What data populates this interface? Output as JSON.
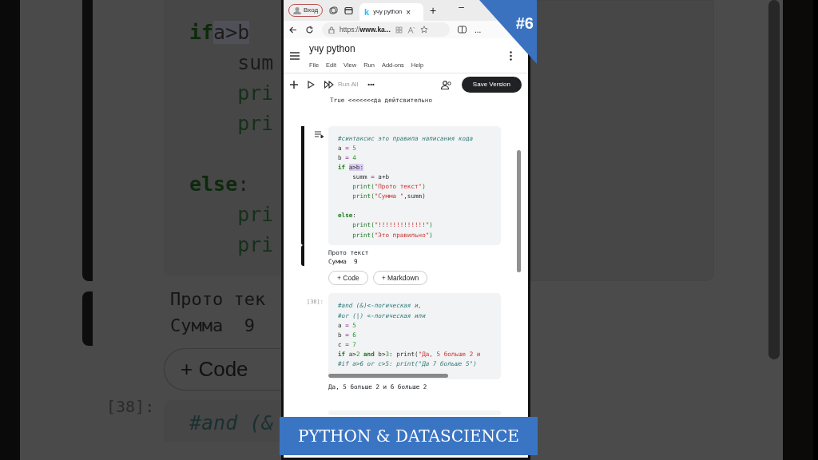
{
  "backdrop": {
    "code_lines": [
      {
        "kind": "code",
        "tokens": [
          {
            "text": "if",
            "kind": "keyword"
          },
          {
            "text": "a>b",
            "kind": "selection"
          }
        ]
      },
      {
        "kind": "code",
        "tokens": [
          {
            "text": "    sum",
            "kind": "plain"
          }
        ]
      },
      {
        "kind": "code",
        "tokens": [
          {
            "text": "    pri",
            "kind": "func"
          }
        ]
      },
      {
        "kind": "code",
        "tokens": [
          {
            "text": "    pri",
            "kind": "func"
          }
        ]
      },
      {
        "kind": "blank"
      },
      {
        "kind": "code",
        "tokens": [
          {
            "text": "else",
            "kind": "keyword"
          },
          {
            "text": ":",
            "kind": "plain"
          }
        ]
      },
      {
        "kind": "code",
        "tokens": [
          {
            "text": "    pri",
            "kind": "func"
          }
        ]
      },
      {
        "kind": "code",
        "tokens": [
          {
            "text": "    pri",
            "kind": "func"
          }
        ]
      }
    ],
    "output": [
      "Прото тек",
      "Сумма  9"
    ],
    "add_button": "+ Code",
    "prompt": "[38]:",
    "next_line": {
      "kind": "code",
      "tokens": [
        {
          "text": "#and (&",
          "kind": "comment"
        }
      ]
    }
  },
  "browser": {
    "profile": "Вход",
    "tab": {
      "icon_letter": "k",
      "title": "учу python",
      "close": "×"
    },
    "new_tab": "+",
    "minimize": "–",
    "url": {
      "scheme": "https://",
      "host": "www.ka..."
    },
    "more": "..."
  },
  "notebook": {
    "title": "учу python",
    "menu": [
      "File",
      "Edit",
      "View",
      "Run",
      "Add-ons",
      "Help"
    ],
    "toolbar": {
      "run_all": "Run All",
      "more": "•••",
      "save": "Save Version"
    },
    "prev_output": "True <<<<<<<да дейтсвительно",
    "cells": [
      {
        "selected": true,
        "hscroll": false,
        "lines": [
          {
            "kind": "code",
            "tokens": [
              {
                "text": "#синтаксис это правила написания кода",
                "kind": "comment"
              }
            ]
          },
          {
            "kind": "code",
            "tokens": [
              {
                "text": "a ",
                "kind": "plain"
              },
              {
                "text": "=",
                "kind": "op"
              },
              {
                "text": " 5",
                "kind": "number"
              }
            ]
          },
          {
            "kind": "code",
            "tokens": [
              {
                "text": "b ",
                "kind": "plain"
              },
              {
                "text": "=",
                "kind": "op"
              },
              {
                "text": " 4",
                "kind": "number"
              }
            ]
          },
          {
            "kind": "code",
            "tokens": [
              {
                "text": "if ",
                "kind": "keyword"
              },
              {
                "text": "a>b:",
                "kind": "selection"
              }
            ]
          },
          {
            "kind": "code",
            "tokens": [
              {
                "text": "    summ ",
                "kind": "plain"
              },
              {
                "text": "=",
                "kind": "op"
              },
              {
                "text": " a+b",
                "kind": "plain"
              }
            ]
          },
          {
            "kind": "code",
            "tokens": [
              {
                "text": "    print(",
                "kind": "func"
              },
              {
                "text": "\"Прото текст\"",
                "kind": "string"
              },
              {
                "text": ")",
                "kind": "func"
              }
            ]
          },
          {
            "kind": "code",
            "tokens": [
              {
                "text": "    print(",
                "kind": "func"
              },
              {
                "text": "\"Сумма \"",
                "kind": "string"
              },
              {
                "text": ",summ)",
                "kind": "plain"
              }
            ]
          },
          {
            "kind": "blank"
          },
          {
            "kind": "code",
            "tokens": [
              {
                "text": "else",
                "kind": "keyword"
              },
              {
                "text": ":",
                "kind": "plain"
              }
            ]
          },
          {
            "kind": "code",
            "tokens": [
              {
                "text": "    print(",
                "kind": "func"
              },
              {
                "text": "\"!!!!!!!!!!!!!\"",
                "kind": "string"
              },
              {
                "text": ")",
                "kind": "func"
              }
            ]
          },
          {
            "kind": "code",
            "tokens": [
              {
                "text": "    print(",
                "kind": "func"
              },
              {
                "text": "\"Это правильно\"",
                "kind": "string"
              },
              {
                "text": ")",
                "kind": "func"
              }
            ]
          }
        ],
        "output": [
          "Прото текст",
          "Сумма  9"
        ],
        "add_buttons": [
          "+ Code",
          "+ Markdown"
        ]
      },
      {
        "selected": false,
        "prompt": "[38]:",
        "hscroll": true,
        "lines": [
          {
            "kind": "code",
            "tokens": [
              {
                "text": "#and (&)<-логическая и,",
                "kind": "comment"
              }
            ]
          },
          {
            "kind": "code",
            "tokens": [
              {
                "text": "#or (|) <-логическая или",
                "kind": "comment"
              }
            ]
          },
          {
            "kind": "code",
            "tokens": [
              {
                "text": "a ",
                "kind": "plain"
              },
              {
                "text": "=",
                "kind": "op"
              },
              {
                "text": " 5",
                "kind": "number"
              }
            ]
          },
          {
            "kind": "code",
            "tokens": [
              {
                "text": "b ",
                "kind": "plain"
              },
              {
                "text": "=",
                "kind": "op"
              },
              {
                "text": " 6",
                "kind": "number"
              }
            ]
          },
          {
            "kind": "code",
            "tokens": [
              {
                "text": "c ",
                "kind": "plain"
              },
              {
                "text": "=",
                "kind": "op"
              },
              {
                "text": " 7",
                "kind": "number"
              }
            ]
          },
          {
            "kind": "code",
            "tokens": [
              {
                "text": "if",
                "kind": "keyword"
              },
              {
                "text": " a>",
                "kind": "plain"
              },
              {
                "text": "2",
                "kind": "number"
              },
              {
                "text": " and",
                "kind": "keyword"
              },
              {
                "text": " b>",
                "kind": "plain"
              },
              {
                "text": "3",
                "kind": "number"
              },
              {
                "text": ": print(",
                "kind": "plain"
              },
              {
                "text": "\"Да, 5 больше 2 и",
                "kind": "string"
              }
            ]
          },
          {
            "kind": "code",
            "tokens": [
              {
                "text": "#if a>6 or c>5: print(\"Да 7 больше 5\")",
                "kind": "comment"
              }
            ]
          }
        ],
        "output": [
          "Да, 5 больше 2 и 6 больше 2"
        ]
      }
    ]
  },
  "overlay": {
    "episode": "#6",
    "banner": "PYTHON & DATASCIENCE"
  }
}
